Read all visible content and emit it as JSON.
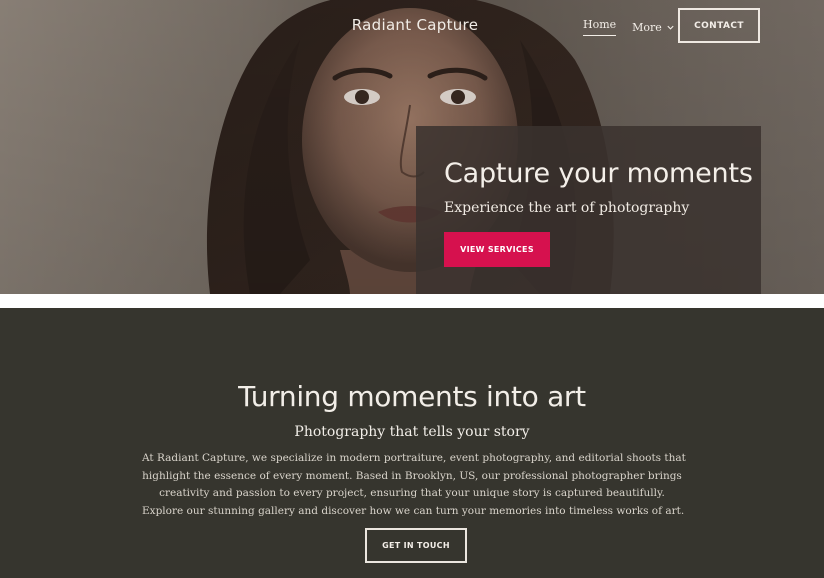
{
  "header": {
    "brand": "Radiant Capture",
    "nav": [
      {
        "label": "Home",
        "active": true
      },
      {
        "label": "More",
        "icon": "chevron-down-icon"
      }
    ],
    "contact_label": "CONTACT"
  },
  "hero": {
    "title": "Capture your moments",
    "subtitle": "Experience the art of photography",
    "cta_label": "VIEW SERVICES",
    "cta_color": "#d6114e"
  },
  "about": {
    "title": "Turning moments into art",
    "subtitle": "Photography that tells your story",
    "body_lines": [
      "At Radiant Capture, we specialize in modern portraiture, event photography, and editorial shoots that",
      "highlight the essence of every moment. Based in Brooklyn, US, our professional photographer brings",
      "creativity and passion to every project, ensuring that your unique story is captured beautifully.",
      "Explore our stunning gallery and discover how we can turn your memories into timeless works of art."
    ],
    "cta_label": "GET IN TOUCH",
    "background": "#36352e"
  }
}
